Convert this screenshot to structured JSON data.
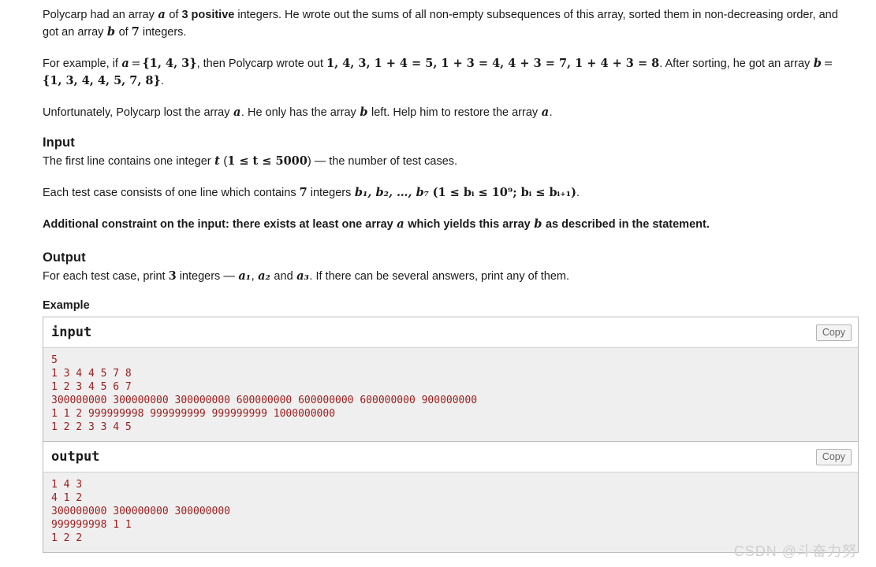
{
  "statement": {
    "p1_before_a": "Polycarp had an array ",
    "p1_var_a": "a",
    "p1_mid1": " of ",
    "p1_bold_3positive": "3 positive",
    "p1_mid2": " integers. He wrote out the sums of all non-empty subsequences of this array, sorted them in non-decreasing order, and got an array ",
    "p1_var_b": "b",
    "p1_mid3": " of ",
    "p1_num_7": "7",
    "p1_end": " integers.",
    "p2_start": "For example, if ",
    "p2_var_a": "a",
    "p2_eq": "=",
    "p2_set_a": "{1, 4, 3}",
    "p2_mid": ", then Polycarp wrote out ",
    "p2_sums": "1, 4, 3, 1 + 4 = 5, 1 + 3 = 4, 4 + 3 = 7, 1 + 4 + 3 = 8",
    "p2_after": ". After sorting, he got an array ",
    "p2_var_b": "b",
    "p2_eq2": "=",
    "p2_set_b": "{1, 3, 4, 4, 5, 7, 8}",
    "p2_end": ".",
    "p3_start": "Unfortunately, Polycarp lost the array ",
    "p3_var_a": "a",
    "p3_mid": ". He only has the array ",
    "p3_var_b": "b",
    "p3_mid2": " left. Help him to restore the array ",
    "p3_var_a2": "a",
    "p3_end": "."
  },
  "input_section": {
    "heading": "Input",
    "line1_start": "The first line contains one integer ",
    "line1_var_t": "t",
    "line1_paren_open": "(",
    "line1_cond": "1 ≤ t ≤ 5000",
    "line1_paren_close": ")",
    "line1_end": " — the number of test cases.",
    "line2_start": "Each test case consists of one line which contains ",
    "line2_num_7": "7",
    "line2_mid": " integers ",
    "line2_vars": "b₁, b₂, …, b₇",
    "line2_constraints": "(1 ≤ bᵢ ≤ 10⁹; bᵢ ≤ bᵢ₊₁)",
    "line2_end": ".",
    "note": "Additional constraint on the input: there exists at least one array a which yields this array b as described in the statement.",
    "note_part1": "Additional constraint on the input: there exists at least one array ",
    "note_var_a": "a",
    "note_part2": " which yields this array ",
    "note_var_b": "b",
    "note_part3": " as described in the statement."
  },
  "output_section": {
    "heading": "Output",
    "line_start": "For each test case, print ",
    "line_num_3": "3",
    "line_mid": " integers — ",
    "line_a1": "a₁",
    "line_comma": ", ",
    "line_a2": "a₂",
    "line_and": " and ",
    "line_a3": "a₃",
    "line_end": ". If there can be several answers, print any of them."
  },
  "example_section": {
    "heading": "Example",
    "copy_label": "Copy",
    "blocks": [
      {
        "title": "input",
        "content": "5\n1 3 4 4 5 7 8\n1 2 3 4 5 6 7\n300000000 300000000 300000000 600000000 600000000 600000000 900000000\n1 1 2 999999998 999999999 999999999 1000000000\n1 2 2 3 3 4 5"
      },
      {
        "title": "output",
        "content": "1 4 3\n4 1 2\n300000000 300000000 300000000\n999999998 1 1\n1 2 2"
      }
    ]
  },
  "watermark": {
    "text": "CSDN @斗奋力努"
  },
  "colors": {
    "code_text": "#9b1c1c",
    "code_bg": "#efefef",
    "border": "#bbbbbb",
    "watermark": "#cfcfcf"
  }
}
